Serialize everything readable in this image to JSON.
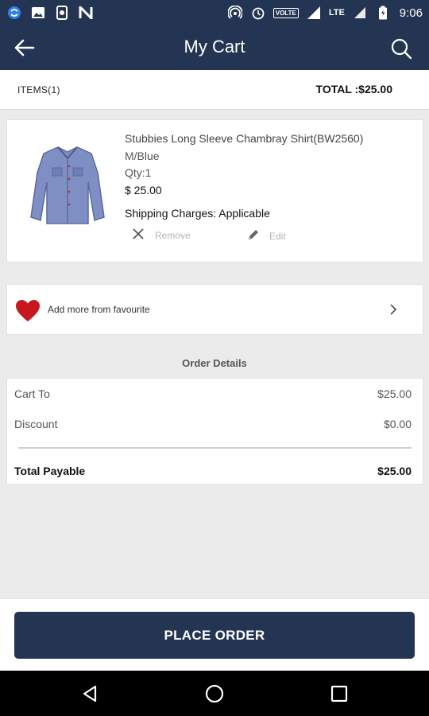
{
  "status_bar": {
    "time": "9:06",
    "volte": "VOLTE",
    "lte": "LTE",
    "left_icons": [
      "sync-icon",
      "image-icon",
      "phone-sync-icon",
      "n-icon"
    ],
    "right_icons": [
      "hotspot-icon",
      "alarm-icon",
      "signal-icon",
      "battery-icon"
    ]
  },
  "app_bar": {
    "title": "My Cart",
    "back_icon": "back-arrow-icon",
    "search_icon": "search-icon"
  },
  "summary": {
    "items": "ITEMS(1)",
    "total": "TOTAL :$25.00"
  },
  "product": {
    "name": "Stubbies Long Sleeve Chambray Shirt(BW2560)",
    "variant": "M/Blue",
    "qty": "Qty:1",
    "price": "$ 25.00",
    "shipping": "Shipping Charges: Applicable",
    "remove_label": "Remove",
    "edit_label": "Edit",
    "image_icon": "shirt-image"
  },
  "favourite": {
    "label": "Add more from favourite",
    "heart_color": "#c8181e"
  },
  "order_details": {
    "title": "Order Details",
    "rows": [
      {
        "label": "Cart To",
        "value": "$25.00"
      },
      {
        "label": "Discount",
        "value": "$0.00"
      }
    ],
    "total_label": "Total Payable",
    "total_value": "$25.00"
  },
  "actions": {
    "place_order": "PLACE ORDER"
  },
  "colors": {
    "primary": "#243453",
    "background": "#ebebeb"
  }
}
